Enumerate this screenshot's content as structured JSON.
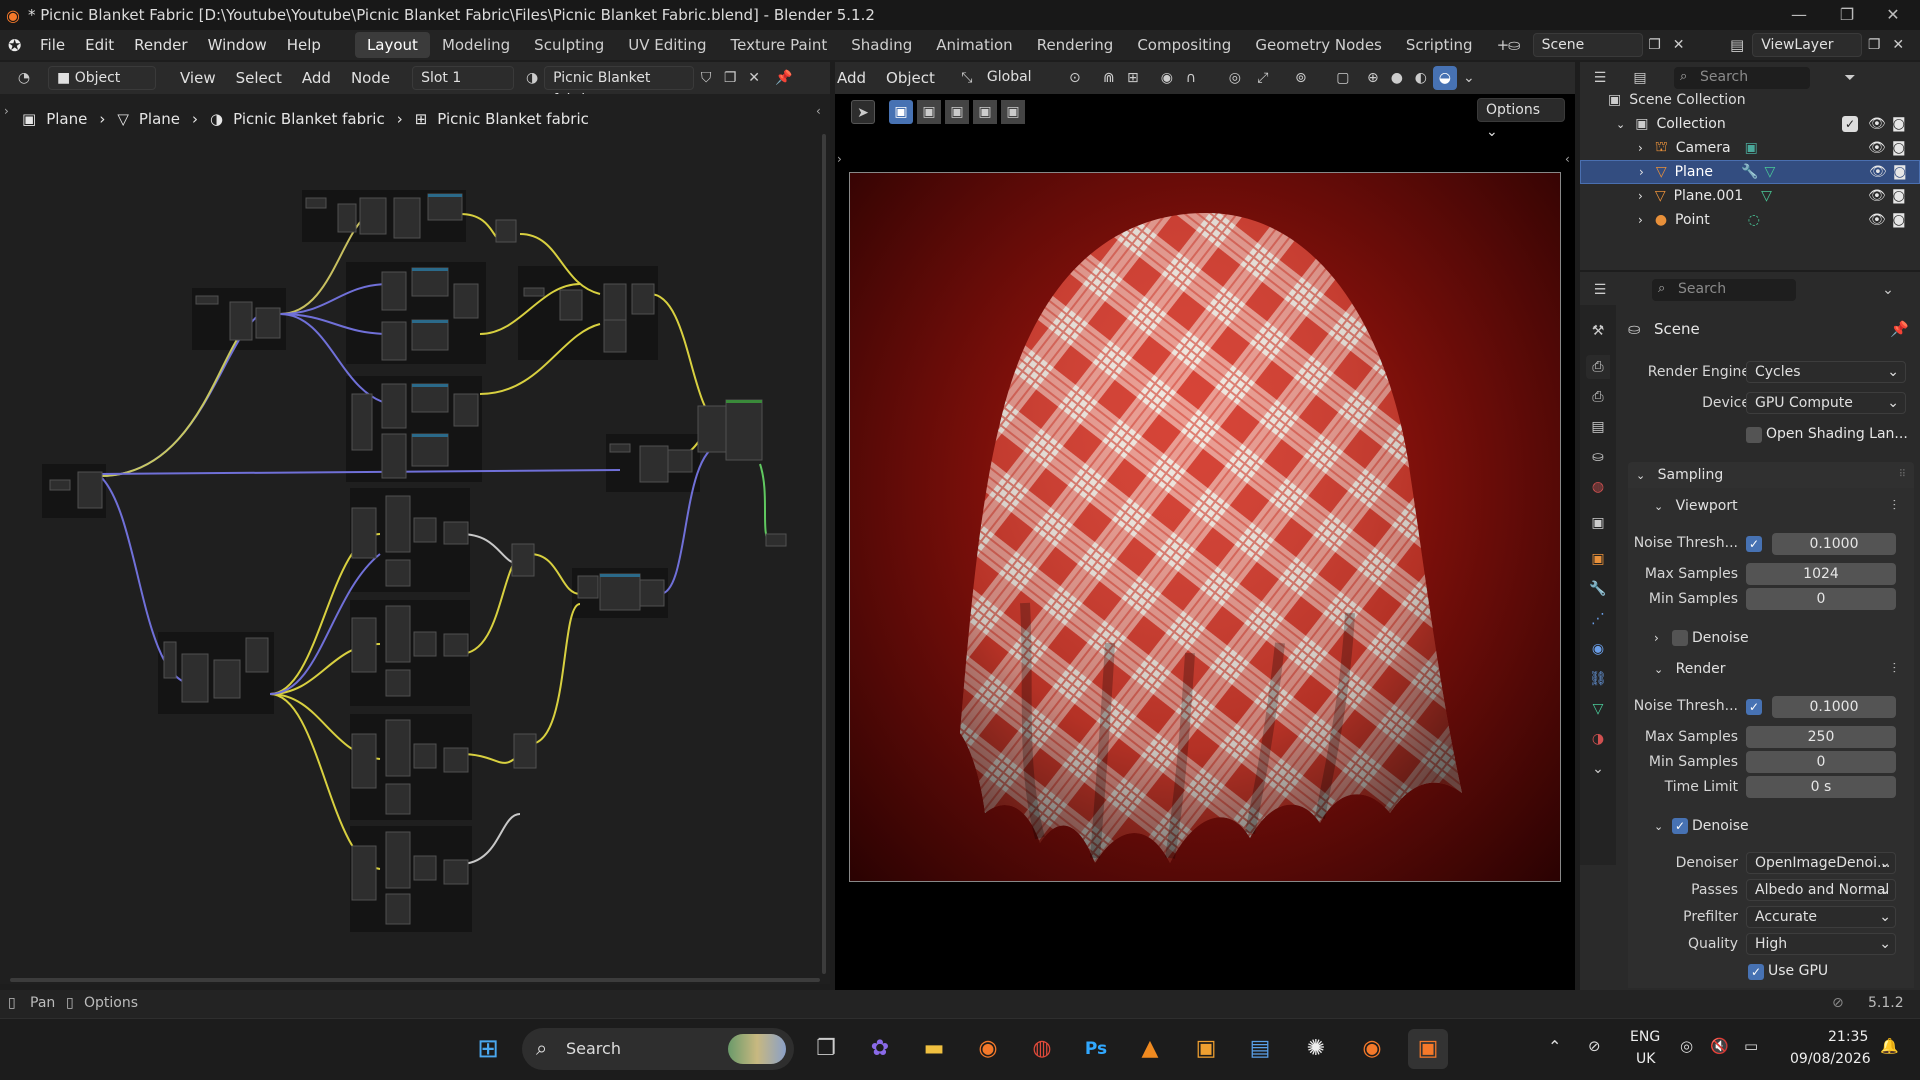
{
  "window": {
    "title": "* Picnic Blanket Fabric [D:\\Youtube\\Youtube\\Picnic Blanket Fabric\\Files\\Picnic Blanket Fabric.blend] - Blender 5.1.2"
  },
  "menubar": {
    "menus": [
      "File",
      "Edit",
      "Render",
      "Window",
      "Help"
    ],
    "workspaces": [
      "Layout",
      "Modeling",
      "Sculpting",
      "UV Editing",
      "Texture Paint",
      "Shading",
      "Animation",
      "Rendering",
      "Compositing",
      "Geometry Nodes",
      "Scripting"
    ],
    "active_workspace": "Layout",
    "scene": "Scene",
    "view_layer": "ViewLayer"
  },
  "node_editor_header": {
    "mode": "Object",
    "menus": [
      "View",
      "Select",
      "Add",
      "Node"
    ],
    "slot": "Slot 1",
    "material": "Picnic Blanket fabric"
  },
  "breadcrumb": [
    "Plane",
    "Plane",
    "Picnic Blanket fabric",
    "Picnic Blanket fabric"
  ],
  "viewport_header": {
    "menus": [
      "Add",
      "Object"
    ],
    "orientation": "Global",
    "options_label": "Options"
  },
  "outliner": {
    "search_placeholder": "Search",
    "root": "Scene Collection",
    "collection": "Collection",
    "items": [
      {
        "name": "Camera",
        "selected": false
      },
      {
        "name": "Plane",
        "selected": true
      },
      {
        "name": "Plane.001",
        "selected": false
      },
      {
        "name": "Point",
        "selected": false
      }
    ]
  },
  "properties": {
    "search_placeholder": "Search",
    "context": "Scene",
    "render_engine_label": "Render Engine",
    "render_engine": "Cycles",
    "device_label": "Device",
    "device": "GPU Compute",
    "osl_label": "Open Shading Lan...",
    "sampling": "Sampling",
    "viewport": {
      "header": "Viewport",
      "noise_label": "Noise Thresh...",
      "noise": "0.1000",
      "max_label": "Max Samples",
      "max": "1024",
      "min_label": "Min Samples",
      "min": "0",
      "denoise": "Denoise"
    },
    "render": {
      "header": "Render",
      "noise_label": "Noise Thresh...",
      "noise": "0.1000",
      "max_label": "Max Samples",
      "max": "250",
      "min_label": "Min Samples",
      "min": "0",
      "time_label": "Time Limit",
      "time": "0 s",
      "denoise": "Denoise",
      "denoiser_label": "Denoiser",
      "denoiser": "OpenImageDenoi...",
      "passes_label": "Passes",
      "passes": "Albedo and Normal",
      "prefilter_label": "Prefilter",
      "prefilter": "Accurate",
      "quality_label": "Quality",
      "quality": "High",
      "use_gpu": "Use GPU"
    }
  },
  "statusbar": {
    "pan": "Pan",
    "options": "Options",
    "version": "5.1.2"
  },
  "taskbar": {
    "search": "Search",
    "lang_top": "ENG",
    "lang_bottom": "UK",
    "time": "21:35",
    "date": "09/08/2026"
  },
  "colors": {
    "accent": "#4772b3",
    "selected_row": "#334d80",
    "gingham_red": "#d8473a",
    "background_red": "#7a0f0a"
  }
}
